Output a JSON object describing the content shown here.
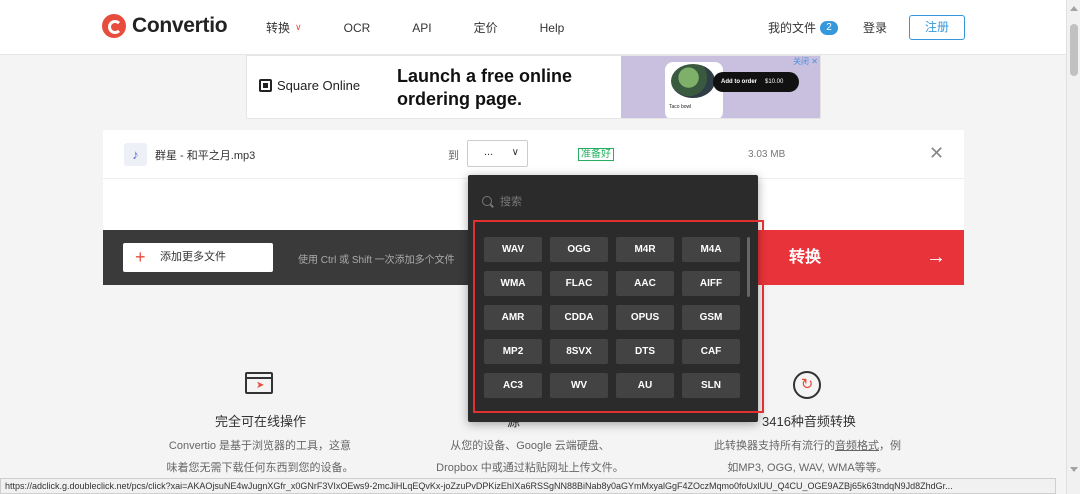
{
  "header": {
    "brand": "Convertio",
    "nav": [
      {
        "label": "转换",
        "has_caret": true
      },
      {
        "label": "OCR"
      },
      {
        "label": "API"
      },
      {
        "label": "定价"
      },
      {
        "label": "Help"
      }
    ],
    "my_files_label": "我的文件",
    "my_files_count": "2",
    "login_label": "登录",
    "signup_label": "注册"
  },
  "ad": {
    "brand": "Square Online",
    "headline": "Launch a free online ordering page.",
    "cart_button": "Add to order",
    "cart_price": "$10.00",
    "item_name": "Taco bowl",
    "close_label": "关闭"
  },
  "file": {
    "name": "群星 - 和平之月.mp3",
    "to_label": "到",
    "selected_format": "...",
    "status": "准备好",
    "size": "3.03 MB"
  },
  "actions": {
    "add_more_label": "添加更多文件",
    "hint": "使用 Ctrl 或 Shift 一次添加多个文件",
    "convert_label": "转换"
  },
  "dropdown": {
    "search_placeholder": "搜索",
    "formats": [
      "WAV",
      "OGG",
      "M4R",
      "M4A",
      "WMA",
      "FLAC",
      "AAC",
      "AIFF",
      "AMR",
      "CDDA",
      "OPUS",
      "GSM",
      "MP2",
      "8SVX",
      "DTS",
      "CAF",
      "AC3",
      "WV",
      "AU",
      "SLN"
    ]
  },
  "features": {
    "f1": {
      "title": "完全可在线操作",
      "line1": "Convertio 是基于浏览器的工具，这意",
      "line2": "味着您无需下载任何东西到您的设备。"
    },
    "f2": {
      "title_partial": "源",
      "line1": "从您的设备、Google 云端硬盘、",
      "line2": "Dropbox 中或通过粘贴网址上传文件。"
    },
    "f3": {
      "title": "3416种音频转换",
      "line1_pre": "此转换器支持所有流行的",
      "line1_link": "音频格式",
      "line1_post": "，例",
      "line2": "如MP3, OGG, WAV, WMA等等。"
    }
  },
  "statusbar": {
    "url": "https://adclick.g.doubleclick.net/pcs/click?xai=AKAOjsuNE4wJugnXGfr_x0GNrF3VIxOEws9-2mcJiHLqEQvKx-joZzuPvDPKizEhIXa6RSSgNN88BiNab8y0aGYmMxyalGgF4ZOczMqmo0foUxlUU_Q4CU_OGE9AZBj65k63tndqN9Jd8ZhdGr..."
  },
  "colors": {
    "accent": "#e8333a",
    "link": "#3498db",
    "ready": "#27ae60",
    "dropdown_bg": "#2b2b2b"
  }
}
